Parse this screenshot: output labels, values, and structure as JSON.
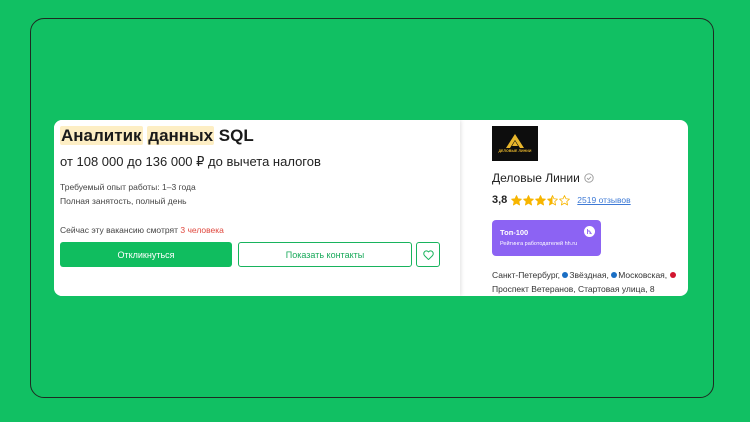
{
  "vacancy": {
    "title_word1": "Аналитик",
    "title_word2": "данных",
    "title_word3": "SQL",
    "salary": "от 108 000 до 136 000 ₽ до вычета налогов",
    "experience": "Требуемый опыт работы: 1–3 года",
    "employment": "Полная занятость, полный день",
    "viewers_prefix": "Сейчас эту вакансию смотрят",
    "viewers_count": "3 человека",
    "apply_label": "Откликнуться",
    "contacts_label": "Показать контакты"
  },
  "company": {
    "logo_text": "ДЕЛОВЫЕ ЛИНИИ",
    "name": "Деловые Линии",
    "rating": "3,8",
    "stars_value": 3.5,
    "stars_max": 5,
    "reviews": "2519 отзывов",
    "badge_title": "Топ-100",
    "badge_subtitle": "Рейтинга работодателей hh.ru",
    "address_city": "Санкт-Петербург,",
    "metro1": "Звёздная,",
    "metro2": "Московская,",
    "metro3": "Проспект Ветеранов,",
    "street": "Стартовая улица, 8"
  },
  "colors": {
    "background": "#11c063",
    "accent": "#10bd5f",
    "highlight": "#fdeec4",
    "badge": "#8c63f3",
    "star": "#f7b500",
    "metro_blue": "#1a6ec4",
    "metro_red": "#d2152f",
    "viewers_count": "#e0483e"
  },
  "icons": {
    "favorite": "heart-icon",
    "verified": "check-circle-icon",
    "badge": "hh-icon",
    "logo": "delovye-linii-logo"
  }
}
